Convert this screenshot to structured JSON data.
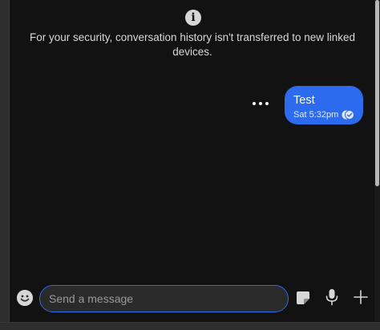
{
  "notice": {
    "icon": "info-icon",
    "text": "For your security, conversation history isn't transferred to new linked devices."
  },
  "messages": [
    {
      "text": "Test",
      "time": "Sat 5:32pm",
      "status": "read",
      "direction": "outgoing",
      "bubble_color": "#2c6bed"
    }
  ],
  "composer": {
    "placeholder": "Send a message",
    "value": ""
  },
  "icons": {
    "message_menu": "more-horizontal-icon",
    "emoji": "emoji-icon",
    "sticker": "sticker-icon",
    "mic": "microphone-icon",
    "attach": "plus-icon",
    "read_receipt": "double-check-icon"
  },
  "colors": {
    "background": "#121212",
    "accent": "#2c6bed",
    "input_background": "#2a2a2a"
  }
}
